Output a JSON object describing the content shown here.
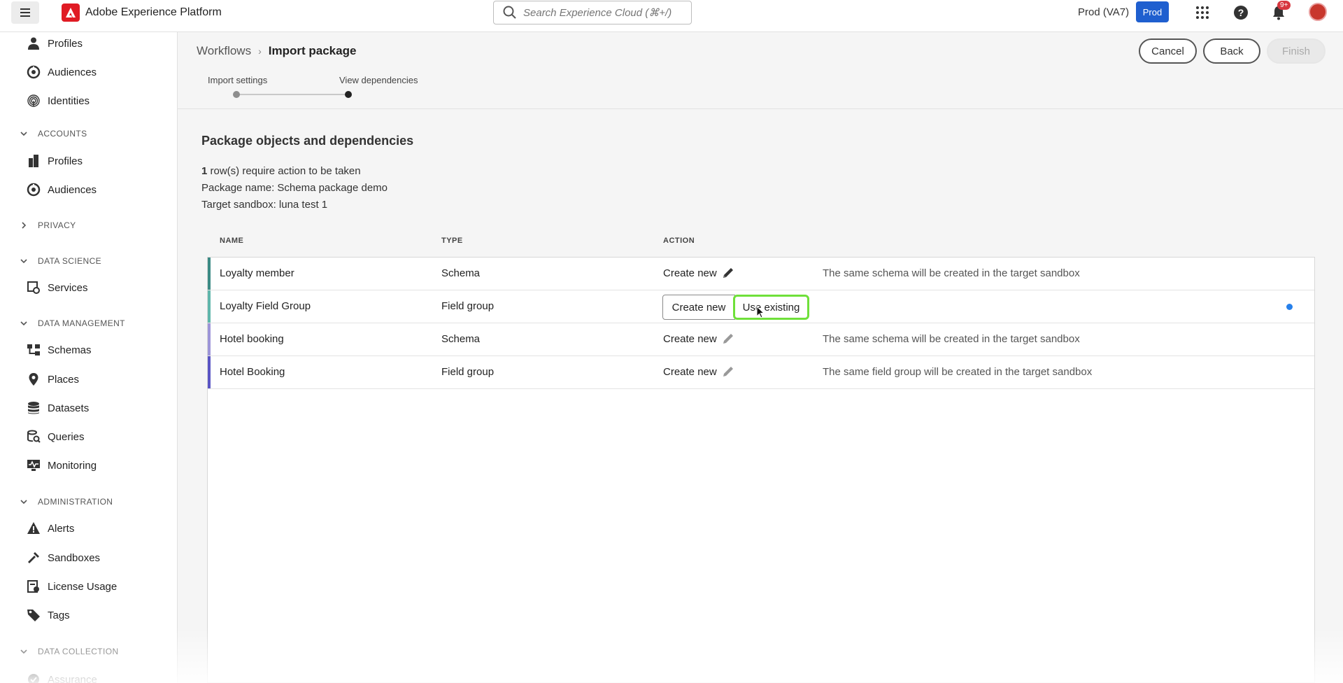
{
  "app": {
    "title": "Adobe Experience Platform",
    "search_placeholder": "Search Experience Cloud (⌘+/)",
    "environment": "Prod (VA7)",
    "environment_badge": "Prod",
    "notification_count": "9+"
  },
  "sidebar": {
    "items": [
      {
        "label": "Profiles",
        "icon": "person-icon"
      },
      {
        "label": "Audiences",
        "icon": "audiences-icon"
      },
      {
        "label": "Identities",
        "icon": "fingerprint-icon"
      },
      {
        "section": "ACCOUNTS",
        "expanded": true
      },
      {
        "label": "Profiles",
        "icon": "building-icon"
      },
      {
        "label": "Audiences",
        "icon": "audiences-icon"
      },
      {
        "section": "PRIVACY",
        "expanded": false
      },
      {
        "section": "DATA SCIENCE",
        "expanded": true
      },
      {
        "label": "Services",
        "icon": "services-icon"
      },
      {
        "section": "DATA MANAGEMENT",
        "expanded": true
      },
      {
        "label": "Schemas",
        "icon": "schema-icon"
      },
      {
        "label": "Places",
        "icon": "pin-icon"
      },
      {
        "label": "Datasets",
        "icon": "database-icon"
      },
      {
        "label": "Queries",
        "icon": "query-icon"
      },
      {
        "label": "Monitoring",
        "icon": "monitor-icon"
      },
      {
        "section": "ADMINISTRATION",
        "expanded": true
      },
      {
        "label": "Alerts",
        "icon": "alert-icon"
      },
      {
        "label": "Sandboxes",
        "icon": "tools-icon"
      },
      {
        "label": "License Usage",
        "icon": "license-icon"
      },
      {
        "label": "Tags",
        "icon": "tag-icon"
      },
      {
        "section": "DATA COLLECTION",
        "expanded": true
      },
      {
        "label": "Assurance",
        "icon": "assurance-icon"
      }
    ]
  },
  "header": {
    "breadcrumb_parent": "Workflows",
    "breadcrumb_current": "Import package",
    "cancel_label": "Cancel",
    "back_label": "Back",
    "finish_label": "Finish",
    "steps": [
      "Import settings",
      "View dependencies"
    ]
  },
  "content": {
    "section_title": "Package objects and dependencies",
    "rows_required_count": "1",
    "rows_required_text": " row(s) require action to be taken",
    "package_name_line": "Package name: Schema package demo",
    "target_sandbox_line": "Target sandbox: luna test 1"
  },
  "table": {
    "columns": [
      "NAME",
      "TYPE",
      "ACTION"
    ],
    "rows": [
      {
        "name": "Loyalty member",
        "type": "Schema",
        "action": "Create new",
        "description": "The same schema will be created in the target sandbox",
        "accent": "#3b8a84"
      },
      {
        "name": "Loyalty Field Group",
        "type": "Field group",
        "action_options": [
          "Create new",
          "Use existing"
        ],
        "description": "",
        "accent": "#5fb6ab"
      },
      {
        "name": "Hotel booking",
        "type": "Schema",
        "action": "Create new",
        "description": "The same schema will be created in the target sandbox",
        "accent": "#9d95d8"
      },
      {
        "name": "Hotel Booking",
        "type": "Field group",
        "action": "Create new",
        "description": "The same field group will be created in the target sandbox",
        "accent": "#5a55c4"
      }
    ]
  }
}
